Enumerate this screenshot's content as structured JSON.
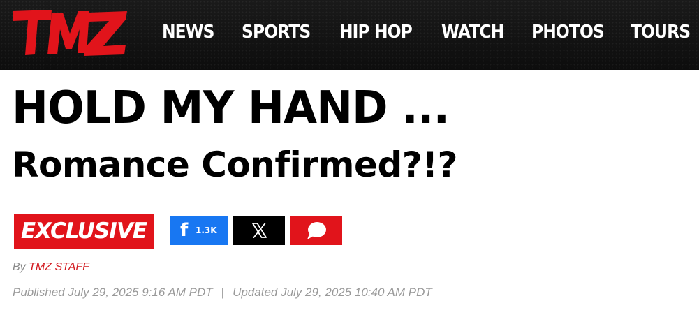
{
  "header": {
    "logo_text": "TMZ",
    "nav": [
      {
        "label": "NEWS"
      },
      {
        "label": "SPORTS"
      },
      {
        "label": "HIP HOP"
      },
      {
        "label": "WATCH"
      },
      {
        "label": "PHOTOS"
      },
      {
        "label": "TOURS"
      }
    ]
  },
  "article": {
    "headline_line1": "HOLD MY HAND ...",
    "headline_line2": "Romance Confirmed?!?",
    "badge": "EXCLUSIVE",
    "share": {
      "facebook_icon": "f",
      "facebook_count": "1.3K",
      "x_icon": "x-logo-icon",
      "comment_icon": "comment-bubble-icon"
    },
    "byline_prefix": "By",
    "author": "TMZ STAFF",
    "published": "Published July 29, 2025 9:16 AM PDT",
    "separator": "|",
    "updated": "Updated July 29, 2025 10:40 AM PDT"
  },
  "colors": {
    "brand_red": "#e1141b",
    "facebook_blue": "#1877f2",
    "header_black": "#141414"
  }
}
